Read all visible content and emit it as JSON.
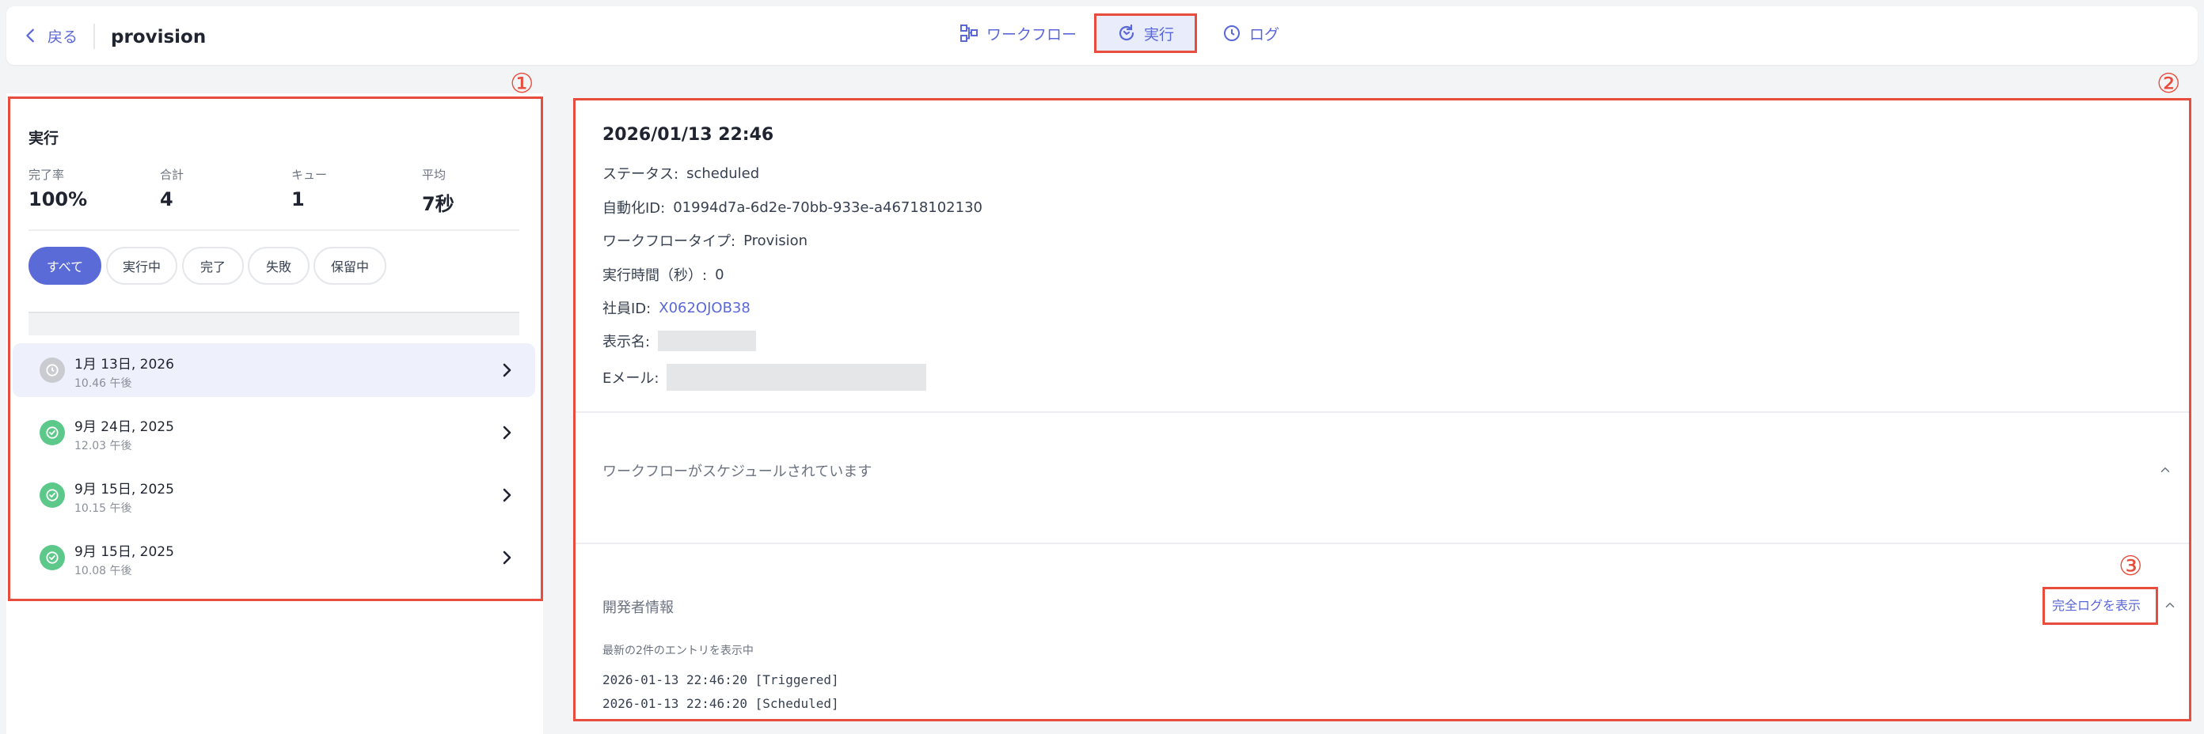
{
  "header": {
    "back_label": "戻る",
    "title": "provision",
    "tabs": [
      {
        "label": "ワークフロー",
        "icon": "workflow-icon"
      },
      {
        "label": "実行",
        "icon": "refresh-icon",
        "active": true
      },
      {
        "label": "ログ",
        "icon": "clock-icon"
      }
    ]
  },
  "annotations": [
    "①",
    "②",
    "③"
  ],
  "left": {
    "section_title": "実行",
    "stats": [
      {
        "label": "完了率",
        "value": "100%"
      },
      {
        "label": "合計",
        "value": "4"
      },
      {
        "label": "キュー",
        "value": "1"
      },
      {
        "label": "平均",
        "value": "7秒"
      }
    ],
    "filters": [
      "すべて",
      "実行中",
      "完了",
      "失敗",
      "保留中"
    ],
    "runs": [
      {
        "date": "1月 13日, 2026",
        "time": "10.46 午後",
        "status": "scheduled"
      },
      {
        "date": "9月 24日, 2025",
        "time": "12.03 午後",
        "status": "completed"
      },
      {
        "date": "9月 15日, 2025",
        "time": "10.15 午後",
        "status": "completed"
      },
      {
        "date": "9月 15日, 2025",
        "time": "10.08 午後",
        "status": "completed"
      }
    ]
  },
  "detail": {
    "title": "2026/01/13 22:46",
    "status_label": "ステータス:",
    "status_value": "scheduled",
    "automation_label": "自動化ID:",
    "automation_value": "01994d7a-6d2e-70bb-933e-a46718102130",
    "workflow_type_label": "ワークフロータイプ:",
    "workflow_type_value": "Provision",
    "duration_label": "実行時間（秒）:",
    "duration_value": "0",
    "employee_label": "社員ID:",
    "employee_value": "X062OJOB38",
    "display_name_label": "表示名:",
    "email_label": "Eメール:",
    "scheduled_message": "ワークフローがスケジュールされています",
    "dev_info_label": "開発者情報",
    "full_log_button": "完全ログを表示",
    "entries_note": "最新の2件のエントリを表示中",
    "log_lines": [
      "2026-01-13 22:46:20 [Triggered]",
      "2026-01-13 22:46:20 [Scheduled]"
    ]
  },
  "colors": {
    "accent": "#5a67d8",
    "success": "#5cc98a",
    "pending": "#c9cbd0",
    "annotation": "#e74c3c"
  }
}
